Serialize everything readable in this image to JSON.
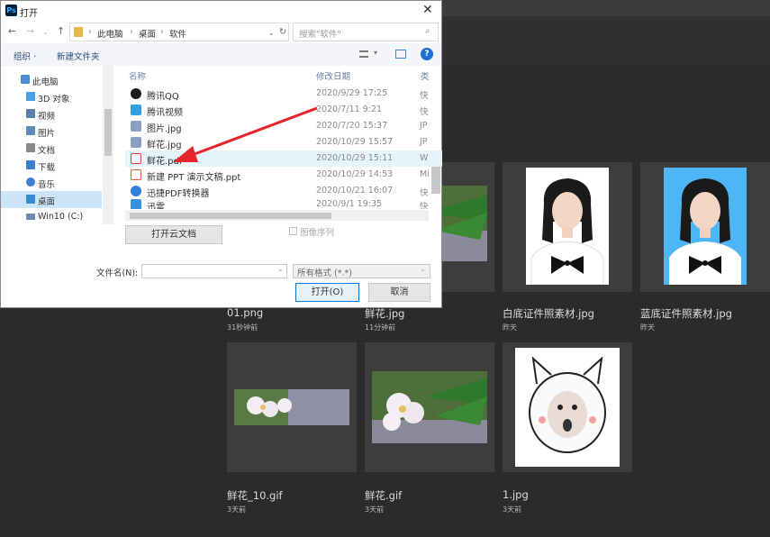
{
  "dialog": {
    "title": "打开",
    "app_logo": "Ps",
    "breadcrumb": [
      "此电脑",
      "桌面",
      "软件"
    ],
    "search_placeholder": "搜索\"软件\"",
    "toolbar": {
      "organize": "组织 ·",
      "new_folder": "新建文件夹"
    },
    "nav": [
      {
        "label": "此电脑",
        "icon": "computer-icon",
        "color": "#4a8fd6"
      },
      {
        "label": "3D 对象",
        "icon": "cube-icon",
        "color": "#4a9fe0"
      },
      {
        "label": "视频",
        "icon": "video-icon",
        "color": "#5a7fa8"
      },
      {
        "label": "图片",
        "icon": "image-icon",
        "color": "#5a8ab8"
      },
      {
        "label": "文档",
        "icon": "document-icon",
        "color": "#8a8a8a"
      },
      {
        "label": "下载",
        "icon": "download-icon",
        "color": "#3a7fd0"
      },
      {
        "label": "音乐",
        "icon": "music-icon",
        "color": "#3a7fd0"
      },
      {
        "label": "桌面",
        "icon": "desktop-icon",
        "color": "#3a8ad0"
      },
      {
        "label": "Win10 (C:)",
        "icon": "drive-icon",
        "color": "#6a8ab0"
      }
    ],
    "columns": {
      "name": "名称",
      "modified": "修改日期",
      "type": "类"
    },
    "files": [
      {
        "name": "腾讯QQ",
        "date": "2020/9/29 17:25",
        "type": "快",
        "icon": "qq-icon",
        "color": "#1a1a1a"
      },
      {
        "name": "腾讯视频",
        "date": "2020/7/11 9:21",
        "type": "快",
        "icon": "tencent-video-icon",
        "color": "#30a0e0"
      },
      {
        "name": "图片.jpg",
        "date": "2020/7/20 15:37",
        "type": "JP",
        "icon": "jpg-file-icon",
        "color": "#8aa0c0"
      },
      {
        "name": "鲜花.jpg",
        "date": "2020/10/29 15:57",
        "type": "JP",
        "icon": "jpg-file-icon",
        "color": "#8aa0c0"
      },
      {
        "name": "鲜花.pdf",
        "date": "2020/10/29 15:11",
        "type": "W",
        "icon": "pdf-file-icon",
        "color": "#e04040"
      },
      {
        "name": "新建 PPT 演示文稿.ppt",
        "date": "2020/10/29 14:53",
        "type": "Mi",
        "icon": "ppt-file-icon",
        "color": "#e06030"
      },
      {
        "name": "迅捷PDF转换器",
        "date": "2020/10/21 16:07",
        "type": "快",
        "icon": "converter-icon",
        "color": "#3080e0"
      },
      {
        "name": "迅雷",
        "date": "2020/9/1 19:35",
        "type": "快",
        "icon": "thunder-icon",
        "color": "#3a90e0"
      }
    ],
    "cloud_button": "打开云文档",
    "sequence_label": "图像序列",
    "filename_label": "文件名(N):",
    "filename_value": "",
    "filetype_value": "所有格式 (*.*)",
    "open_button": "打开(O)",
    "cancel_button": "取消"
  },
  "gallery": [
    {
      "name": "01.png",
      "time": "31秒钟前"
    },
    {
      "name": "鲜花.jpg",
      "time": "11分钟前"
    },
    {
      "name": "白底证件照素材.jpg",
      "time": "昨天"
    },
    {
      "name": "蓝底证件照素材.jpg",
      "time": "昨天"
    },
    {
      "name": "鲜花_10.gif",
      "time": "3天前"
    },
    {
      "name": "鲜花.gif",
      "time": "3天前"
    },
    {
      "name": "1.jpg",
      "time": "3天前"
    }
  ],
  "colors": {
    "accent": "#0078d7",
    "pointer_arrow": "#e8242b",
    "dark_bg": "#2b2b2b"
  }
}
